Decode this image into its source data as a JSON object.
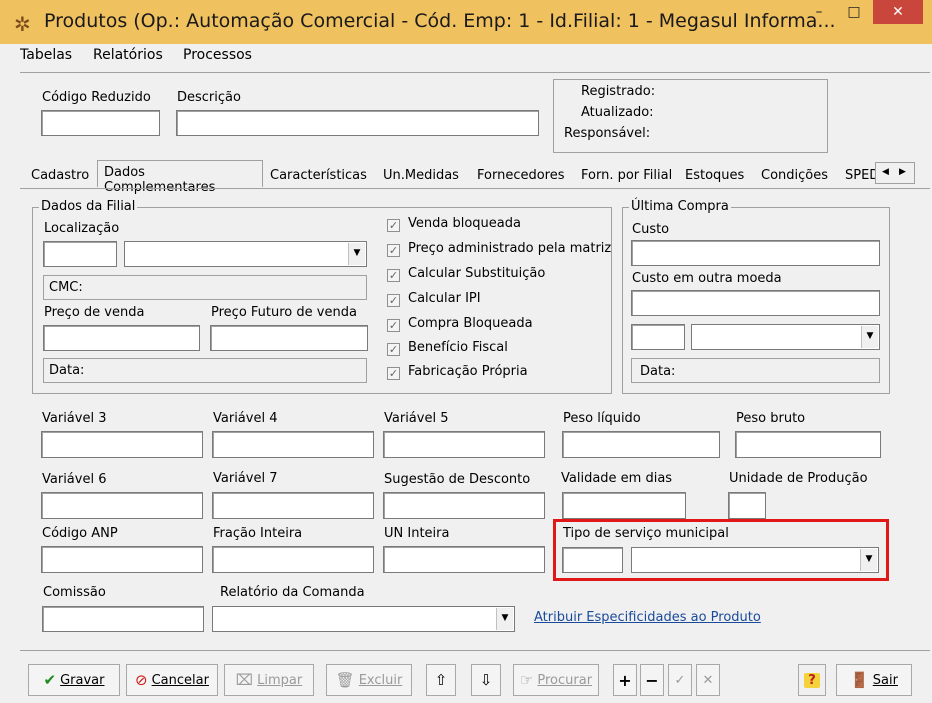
{
  "window": {
    "title": "Produtos (Op.: Automação Comercial - Cód. Emp: 1 - Id.Filial: 1 - Megasul Informa...",
    "minimize": "–",
    "maximize": "□",
    "close": "✕"
  },
  "menu": [
    "Tabelas",
    "Relatórios",
    "Processos"
  ],
  "header": {
    "codigo_label": "Código Reduzido",
    "descricao_label": "Descrição",
    "registrado": "Registrado:",
    "atualizado": "Atualizado:",
    "responsavel": "Responsável:"
  },
  "tabs": {
    "cadastro": "Cadastro",
    "active": "Dados Complementares",
    "caracteristicas": "Características",
    "un_medidas": "Un.Medidas",
    "fornecedores": "Fornecedores",
    "forn_filial": "Forn. por Filial",
    "estoques": "Estoques",
    "condicoes": "Condições",
    "sped": "SPED"
  },
  "filial": {
    "title": "Dados da Filial",
    "localizacao": "Localização",
    "cmc": "CMC:",
    "preco_venda": "Preço de venda",
    "preco_futuro": "Preço Futuro de venda",
    "data": "Data:"
  },
  "checkboxes": [
    {
      "label": "Venda bloqueada",
      "checked": true
    },
    {
      "label": "Preço administrado pela matriz",
      "checked": true
    },
    {
      "label": "Calcular Substituição",
      "checked": true
    },
    {
      "label": "Calcular IPI",
      "checked": true
    },
    {
      "label": "Compra Bloqueada",
      "checked": true
    },
    {
      "label": "Benefício Fiscal",
      "checked": true
    },
    {
      "label": "Fabricação Própria",
      "checked": true
    }
  ],
  "ultima_compra": {
    "title": "Última Compra",
    "custo": "Custo",
    "custo_outra": "Custo em outra moeda",
    "data": "Data:"
  },
  "fields": {
    "variavel3": "Variável 3",
    "variavel4": "Variável 4",
    "variavel5": "Variável 5",
    "peso_liquido": "Peso líquido",
    "peso_bruto": "Peso bruto",
    "variavel6": "Variável 6",
    "variavel7": "Variável 7",
    "sugestao": "Sugestão de Desconto",
    "validade": "Validade em dias",
    "unidade_prod": "Unidade de Produção",
    "codigo_anp": "Código ANP",
    "fracao": "Fração Inteira",
    "un_inteira": "UN Inteira",
    "tipo_servico": "Tipo de serviço municipal",
    "comissao": "Comissão",
    "relatorio": "Relatório da Comanda",
    "atribuir_link": "Atribuir Especificidades ao Produto"
  },
  "toolbar": {
    "gravar": "Gravar",
    "cancelar": "Cancelar",
    "limpar": "Limpar",
    "excluir": "Excluir",
    "procurar": "Procurar",
    "help": "?",
    "sair": "Sair"
  },
  "colors": {
    "titlebar": "#f0c15f",
    "highlight": "#e11818",
    "close": "#c9463d"
  }
}
